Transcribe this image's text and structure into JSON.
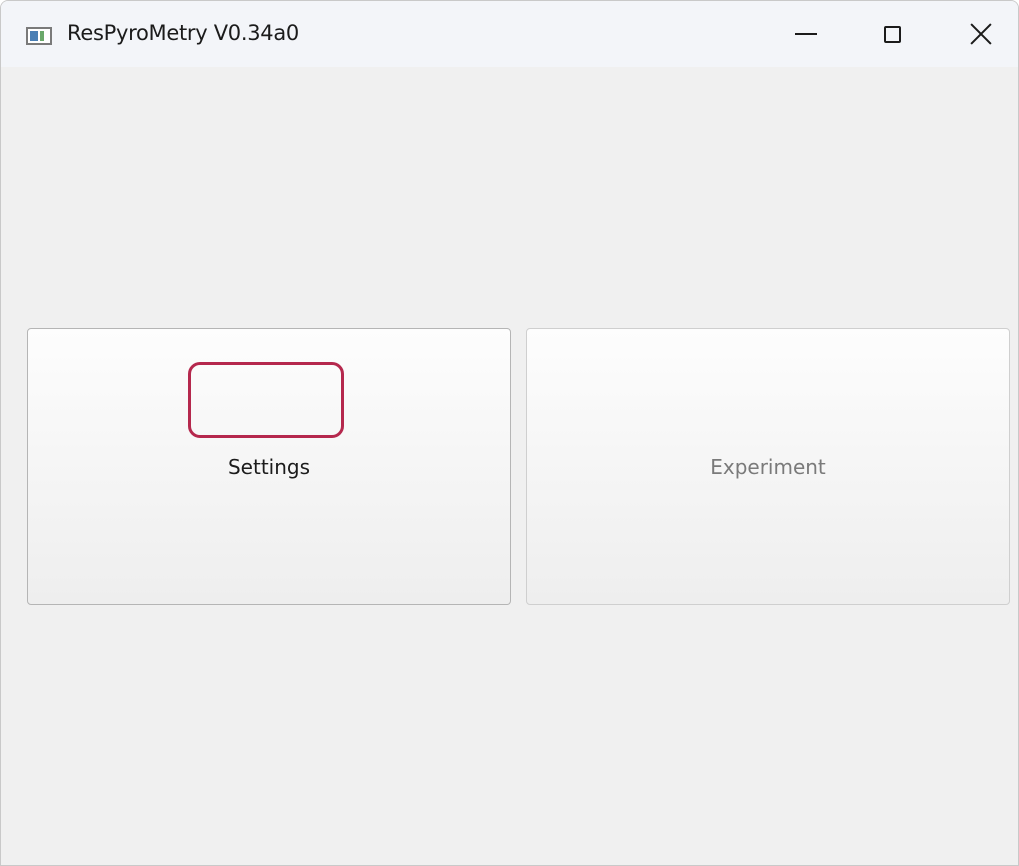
{
  "window": {
    "title": "ResPyroMetry V0.34a0",
    "app_icon": "app-window-icon"
  },
  "title_controls": {
    "minimize_icon": "minimize-icon",
    "maximize_icon": "maximize-icon",
    "close_icon": "close-icon"
  },
  "main": {
    "settings_label": "Settings",
    "experiment_label": "Experiment",
    "experiment_state": "disabled"
  },
  "colors": {
    "background": "#f0f0f0",
    "titlebar": "#f3f5f9",
    "highlight": "#b5284d",
    "disabled_text": "#7a7a7a"
  }
}
